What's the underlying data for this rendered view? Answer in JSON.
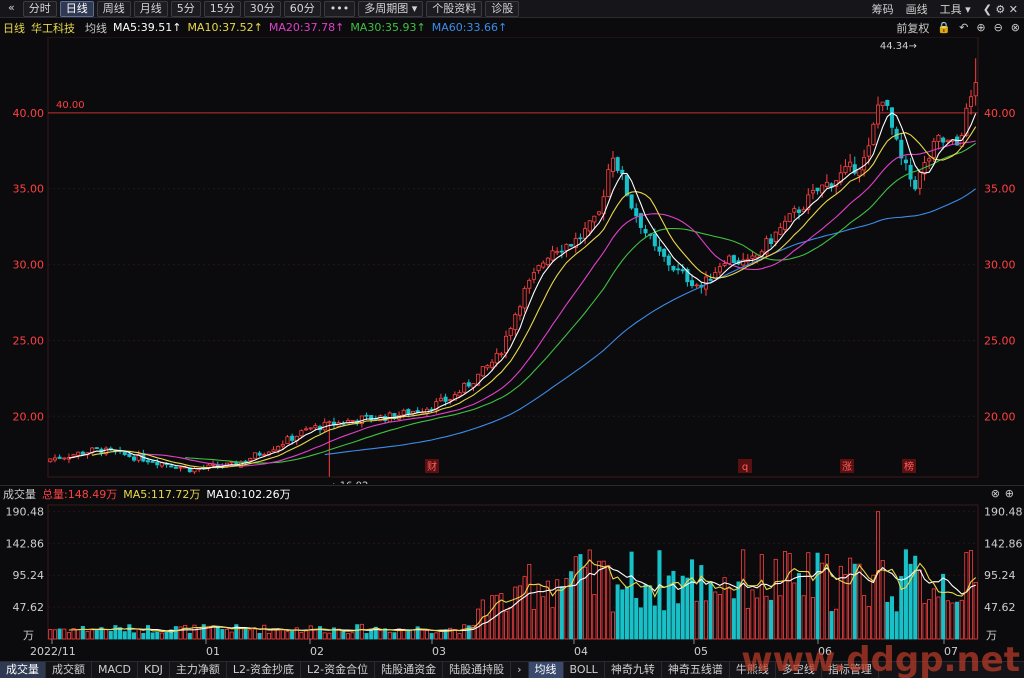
{
  "toolbar": {
    "back_glyph": "«",
    "items": [
      {
        "label": "分时",
        "active": false
      },
      {
        "label": "日线",
        "active": true
      },
      {
        "label": "周线",
        "active": false
      },
      {
        "label": "月线",
        "active": false
      },
      {
        "label": "5分",
        "active": false
      },
      {
        "label": "15分",
        "active": false
      },
      {
        "label": "30分",
        "active": false
      },
      {
        "label": "60分",
        "active": false
      },
      {
        "label": "•••",
        "active": false
      },
      {
        "label": "多周期图 ▾",
        "active": false
      },
      {
        "label": "个股资料",
        "active": false
      },
      {
        "label": "诊股",
        "active": false
      }
    ],
    "right": {
      "chouma": "筹码",
      "huaxian": "画线",
      "gongju": "工具 ▾",
      "win_controls": "❮ ⚙ ✕"
    }
  },
  "info": {
    "period": "日线",
    "name": "华工科技",
    "avg": "均线",
    "ma5": "MA5:39.51↑",
    "ma10": "MA10:37.52↑",
    "ma20": "MA20:37.78↑",
    "ma30": "MA30:35.93↑",
    "ma60": "MA60:33.66↑",
    "right_label": "前复权"
  },
  "colors": {
    "up": "#ff4040",
    "down": "#18c0c8",
    "ma5": "#ffffff",
    "ma10": "#e8d84a",
    "ma20": "#e040c8",
    "ma30": "#40c040",
    "ma60": "#3c8ce8",
    "grid": "#3a1818"
  },
  "price_chart": {
    "y_ticks": [
      "40.00",
      "35.00",
      "30.00",
      "25.00",
      "20.00"
    ],
    "ref_line_label": "40.00",
    "high_marker": "44.34→",
    "low_marker": "←16.02",
    "event_labels": [
      "财",
      "q",
      "涨",
      "榜"
    ],
    "x_labels": [
      "2022/11",
      "01",
      "02",
      "03",
      "04",
      "05",
      "06",
      "07"
    ]
  },
  "volume": {
    "title": "成交量",
    "total": "总量:148.49万",
    "ma5": "MA5:117.72万",
    "ma10": "MA10:102.26万",
    "y_ticks": [
      "190.48",
      "142.86",
      "95.24",
      "47.62",
      "万"
    ]
  },
  "bottom_tabs": [
    "成交量",
    "成交额",
    "MACD",
    "KDJ",
    "主力净额",
    "L2-资金抄底",
    "L2-资金合位",
    "陆股通资金",
    "陆股通持股",
    "›",
    "均线",
    "BOLL",
    "神奇九转",
    "神奇五线谱",
    "牛熊线",
    "多空线",
    "指标管理"
  ],
  "watermark": "www.ddgp.net"
}
